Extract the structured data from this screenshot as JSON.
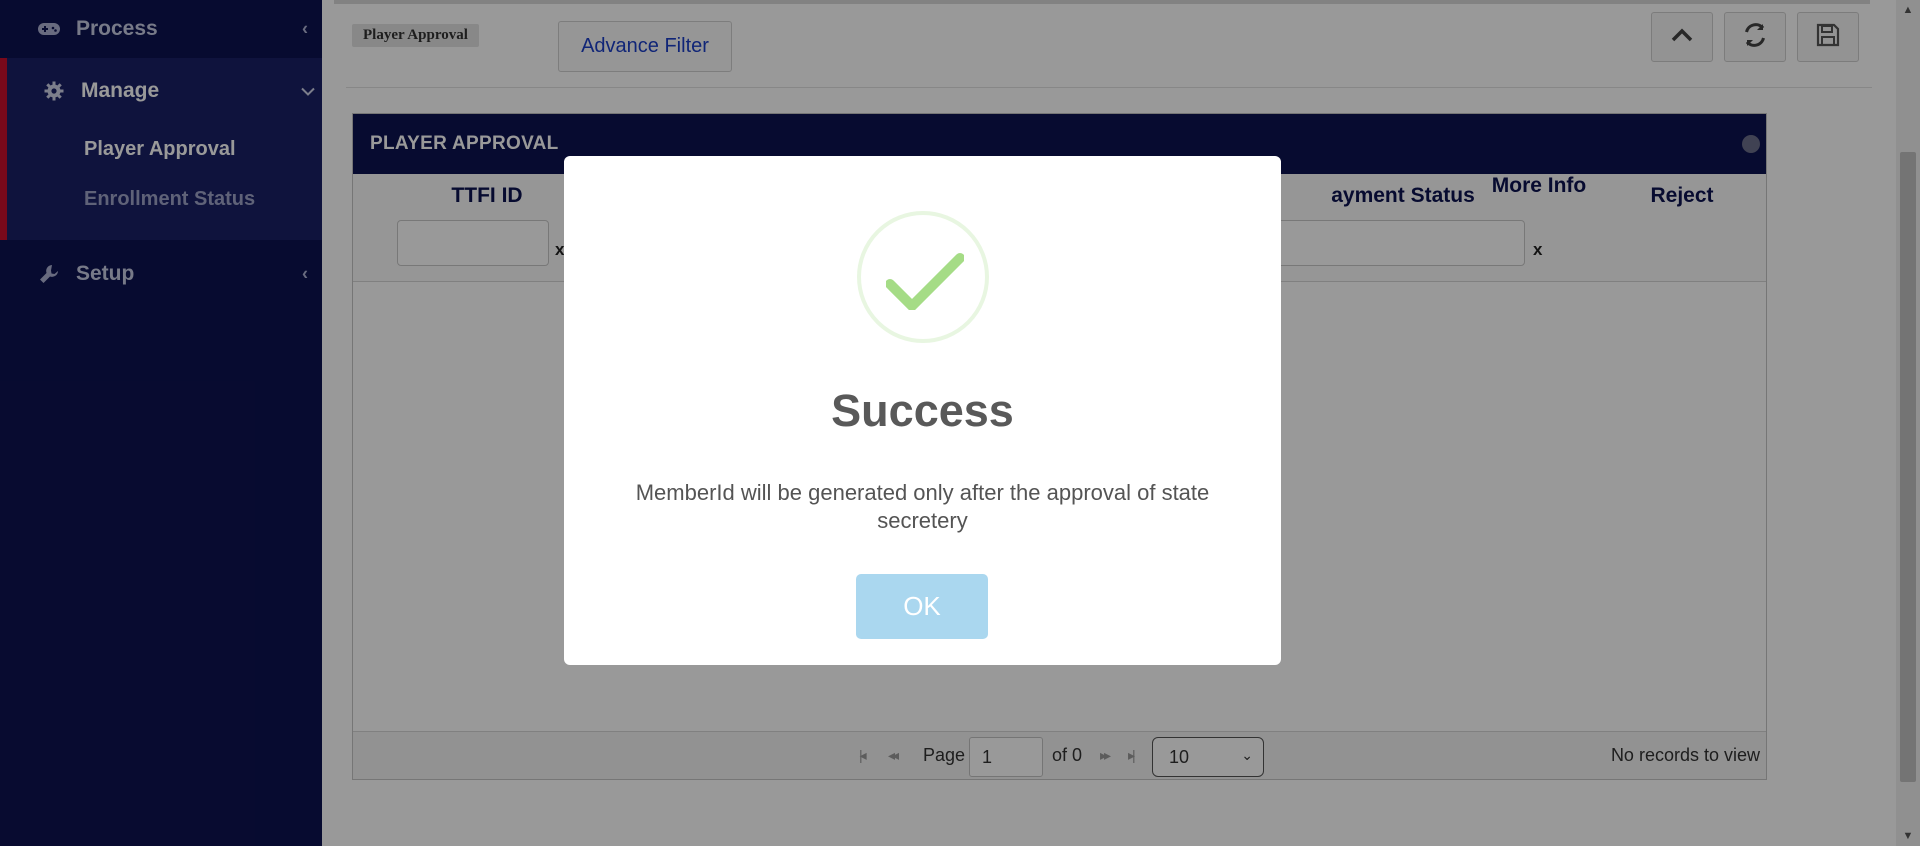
{
  "colors": {
    "sidebar_bg": "#0d1350",
    "active_bg": "#1a2166",
    "active_border": "#c8102e",
    "grid_header_bg": "#0d1350",
    "link_blue": "#1c3fc7",
    "success_green": "#a5dc86",
    "ok_button": "#aad7ef"
  },
  "sidebar": {
    "process": {
      "label": "Process",
      "icon": "gamepad-icon",
      "chevron": "‹"
    },
    "manage": {
      "label": "Manage",
      "icon": "gear-icon",
      "chevron": "⌄",
      "children": [
        {
          "label": "Player Approval"
        },
        {
          "label": "Enrollment Status"
        }
      ]
    },
    "setup": {
      "label": "Setup",
      "icon": "wrench-icon",
      "chevron": "‹"
    }
  },
  "toolbar": {
    "breadcrumb_tag": "Player Approval",
    "advance_filter": "Advance Filter",
    "buttons": [
      "chevron-up-icon",
      "refresh-icon",
      "save-icon"
    ]
  },
  "grid": {
    "title": "PLAYER APPROVAL",
    "columns": {
      "ttfi_id": "TTFI ID",
      "payment_status": "ayment Status",
      "more_info": "More Info",
      "reject": "Reject"
    },
    "filter_clear": "x",
    "pager": {
      "page_label": "Page",
      "page_value": "1",
      "of_label": "of 0",
      "page_size": "10",
      "records_text": "No records to view"
    }
  },
  "modal": {
    "icon": "success-check-icon",
    "title": "Success",
    "message": "MemberId will be generated only after the approval of state secretery",
    "ok_label": "OK"
  }
}
